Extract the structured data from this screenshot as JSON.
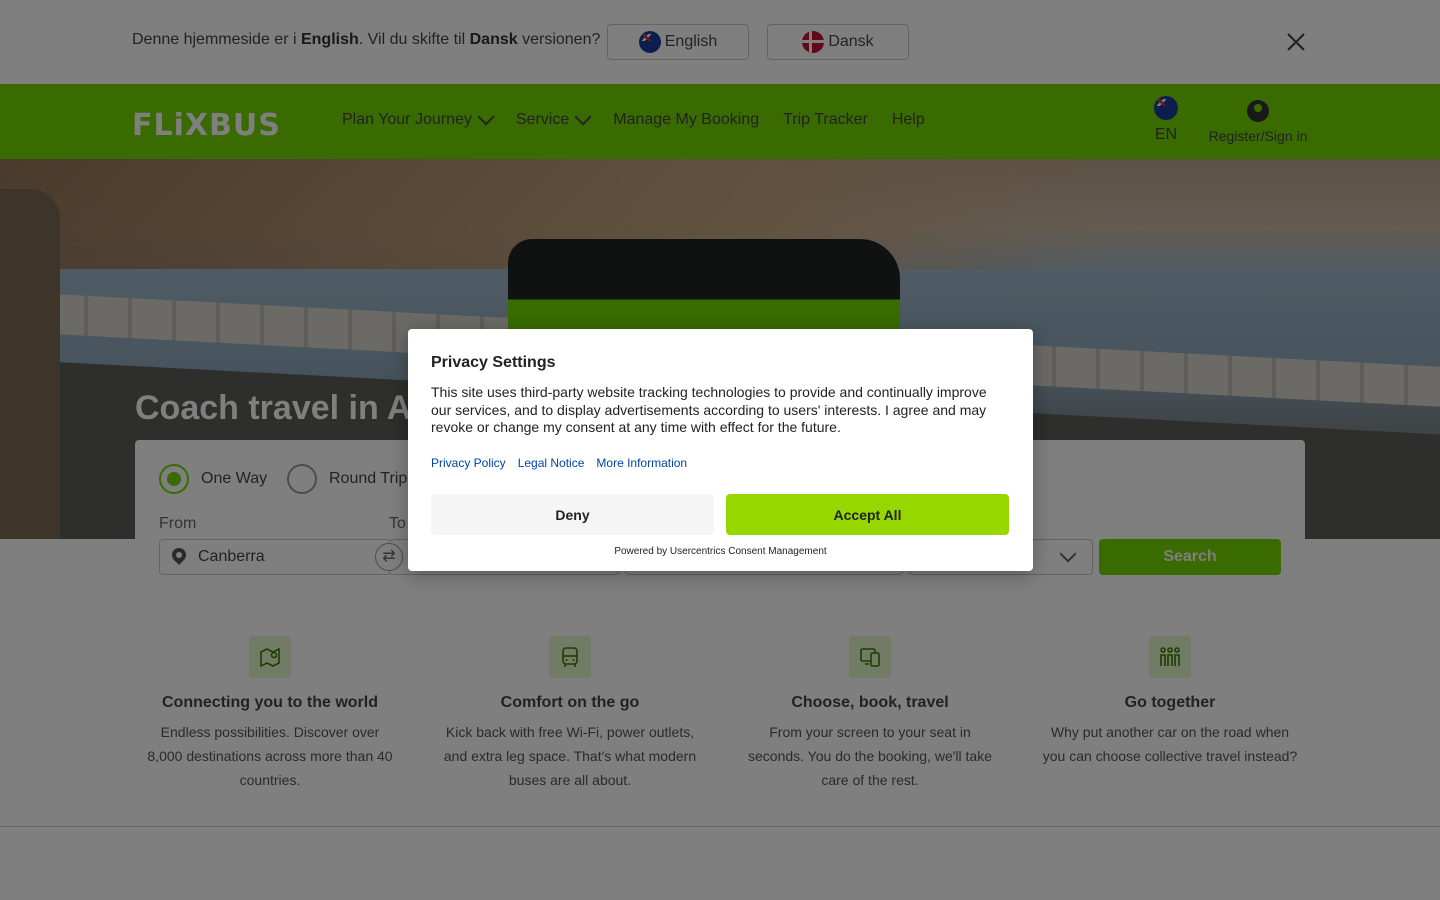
{
  "lang_bar": {
    "message_prefix": "Denne hjemmeside er i ",
    "message_current": "English",
    "message_mid": ". Vil du skifte til ",
    "message_target": "Dansk",
    "message_suffix": " versionen?",
    "english_label": "English",
    "dansk_label": "Dansk",
    "close_icon": "close-icon"
  },
  "header": {
    "logo": "FLiXBUS",
    "nav": [
      "Plan Your Journey",
      "Service",
      "Manage My Booking",
      "Trip Tracker",
      "Help"
    ],
    "language_code": "EN",
    "account_label": "Register/Sign in",
    "brand_color": "#73d700"
  },
  "hero": {
    "title": "Coach travel in Au"
  },
  "search": {
    "trip_types": [
      "One Way",
      "Round Trip"
    ],
    "selected_trip_type": "One Way",
    "from_label": "From",
    "to_label": "To",
    "from_value": "Canberra",
    "search_label": "Search"
  },
  "features": [
    {
      "icon": "map-pin-icon",
      "title": "Connecting you to the world",
      "text": "Endless possibilities. Discover over 8,000 destinations across more than 40 countries."
    },
    {
      "icon": "bus-icon",
      "title": "Comfort on the go",
      "text": "Kick back with free Wi-Fi, power outlets, and extra leg space. That's what modern buses are all about."
    },
    {
      "icon": "devices-icon",
      "title": "Choose, book, travel",
      "text": "From your screen to your seat in seconds. You do the booking, we'll take care of the rest."
    },
    {
      "icon": "group-icon",
      "title": "Go together",
      "text": "Why put another car on the road when you can choose collective travel instead?"
    }
  ],
  "privacy_modal": {
    "title": "Privacy Settings",
    "body": "This site uses third-party website tracking technologies to provide and continually improve our services, and to display advertisements according to users' interests. I agree and may revoke or change my consent at any time with effect for the future.",
    "links": [
      "Privacy Policy",
      "Legal Notice",
      "More Information"
    ],
    "deny_label": "Deny",
    "accept_label": "Accept All",
    "powered_by": "Powered by Usercentrics Consent Management",
    "accept_color": "#97d700",
    "link_color": "#0045a5"
  }
}
